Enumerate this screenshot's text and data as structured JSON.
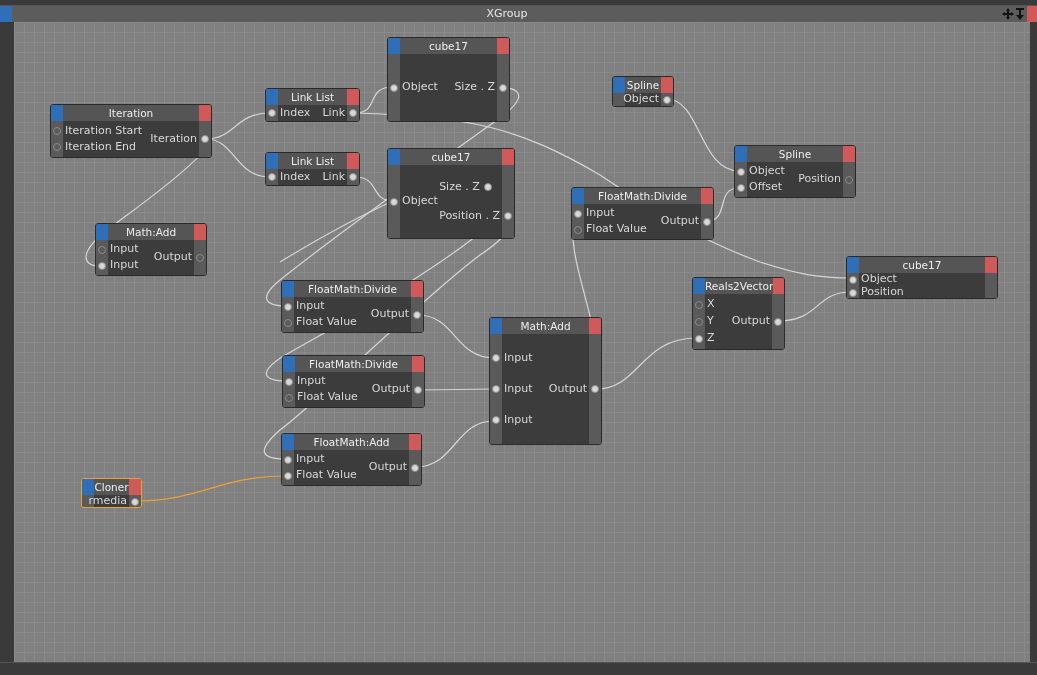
{
  "window": {
    "title": "XGroup"
  },
  "nodes": [
    {
      "title": "Iteration",
      "selected": false,
      "ports": [
        {
          "label": "Iteration Start",
          "kind": "input",
          "connected": false
        },
        {
          "label": "Iteration End",
          "kind": "input",
          "connected": false
        },
        {
          "label": "Iteration",
          "kind": "output",
          "connected": true
        }
      ]
    },
    {
      "title": "Link List",
      "selected": false,
      "ports": [
        {
          "label": "Index",
          "kind": "input",
          "connected": true
        },
        {
          "label": "Link",
          "kind": "output",
          "connected": true
        }
      ]
    },
    {
      "title": "cube17",
      "selected": false,
      "ports": [
        {
          "label": "Object",
          "kind": "input",
          "connected": true
        },
        {
          "label": "Size . Z",
          "kind": "output",
          "connected": true
        }
      ]
    },
    {
      "title": "Spline",
      "selected": false,
      "ports": [
        {
          "label": "Object",
          "kind": "output",
          "connected": true
        }
      ]
    },
    {
      "title": "Link List",
      "selected": false,
      "ports": [
        {
          "label": "Index",
          "kind": "input",
          "connected": true
        },
        {
          "label": "Link",
          "kind": "output",
          "connected": true
        }
      ]
    },
    {
      "title": "cube17",
      "selected": false,
      "ports": [
        {
          "label": "Object",
          "kind": "input",
          "connected": true
        },
        {
          "label": "Size . Z",
          "kind": "output",
          "connected": true
        },
        {
          "label": "Position . Z",
          "kind": "output",
          "connected": true
        }
      ]
    },
    {
      "title": "Math:Add",
      "selected": false,
      "ports": [
        {
          "label": "Input",
          "kind": "input",
          "connected": false
        },
        {
          "label": "Input",
          "kind": "input",
          "connected": true
        },
        {
          "label": "Output",
          "kind": "output",
          "connected": false
        }
      ]
    },
    {
      "title": "FloatMath:Divide",
      "selected": false,
      "ports": [
        {
          "label": "Input",
          "kind": "input",
          "connected": true
        },
        {
          "label": "Float Value",
          "kind": "input",
          "connected": false
        },
        {
          "label": "Output",
          "kind": "output",
          "connected": true
        }
      ]
    },
    {
      "title": "Spline",
      "selected": false,
      "ports": [
        {
          "label": "Object",
          "kind": "input",
          "connected": true
        },
        {
          "label": "Offset",
          "kind": "input",
          "connected": true
        },
        {
          "label": "Position",
          "kind": "output",
          "connected": false
        }
      ]
    },
    {
      "title": "cube17",
      "selected": false,
      "ports": [
        {
          "label": "Object",
          "kind": "input",
          "connected": true
        },
        {
          "label": "Position",
          "kind": "input",
          "connected": true
        }
      ]
    },
    {
      "title": "FloatMath:Divide",
      "selected": false,
      "ports": [
        {
          "label": "Input",
          "kind": "input",
          "connected": true
        },
        {
          "label": "Float Value",
          "kind": "input",
          "connected": false
        },
        {
          "label": "Output",
          "kind": "output",
          "connected": true
        }
      ]
    },
    {
      "title": "Reals2Vector",
      "selected": false,
      "ports": [
        {
          "label": "X",
          "kind": "input",
          "connected": false
        },
        {
          "label": "Y",
          "kind": "input",
          "connected": false
        },
        {
          "label": "Z",
          "kind": "input",
          "connected": true
        },
        {
          "label": "Output",
          "kind": "output",
          "connected": true
        }
      ]
    },
    {
      "title": "Math:Add",
      "selected": false,
      "ports": [
        {
          "label": "Input",
          "kind": "input",
          "connected": true
        },
        {
          "label": "Input",
          "kind": "input",
          "connected": true
        },
        {
          "label": "Input",
          "kind": "input",
          "connected": true
        },
        {
          "label": "Output",
          "kind": "output",
          "connected": true
        }
      ]
    },
    {
      "title": "FloatMath:Divide",
      "selected": false,
      "ports": [
        {
          "label": "Input",
          "kind": "input",
          "connected": true
        },
        {
          "label": "Float Value",
          "kind": "input",
          "connected": false
        },
        {
          "label": "Output",
          "kind": "output",
          "connected": true
        }
      ]
    },
    {
      "title": "FloatMath:Add",
      "selected": false,
      "ports": [
        {
          "label": "Input",
          "kind": "input",
          "connected": true
        },
        {
          "label": "Float Value",
          "kind": "input",
          "connected": true
        },
        {
          "label": "Output",
          "kind": "output",
          "connected": true
        }
      ]
    },
    {
      "title": "Cloner",
      "selected": true,
      "ports": [
        {
          "label": "rmedia",
          "kind": "output",
          "connected": true
        }
      ]
    }
  ]
}
